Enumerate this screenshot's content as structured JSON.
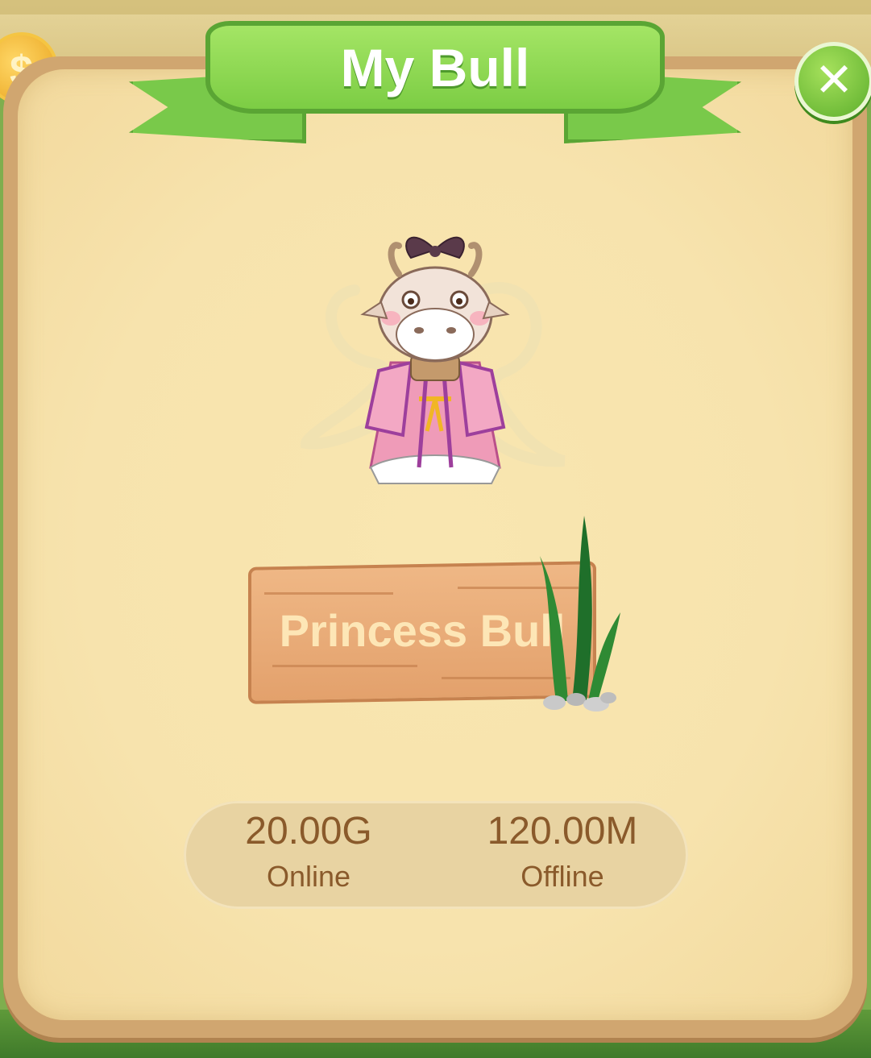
{
  "header": {
    "title": "My Bull"
  },
  "pet": {
    "name": "Princess Bull"
  },
  "stats": [
    {
      "value": "20.00G",
      "label": "Online"
    },
    {
      "value": "120.00M",
      "label": "Offline"
    }
  ],
  "icons": {
    "close": "close-icon",
    "coin": "coin-icon",
    "character": "princess-bull-character",
    "grass": "grass-decoration"
  },
  "colors": {
    "ribbon": "#7ccd44",
    "panel_bg": "#f7e3ad",
    "stat_text": "#8a5a2b"
  }
}
